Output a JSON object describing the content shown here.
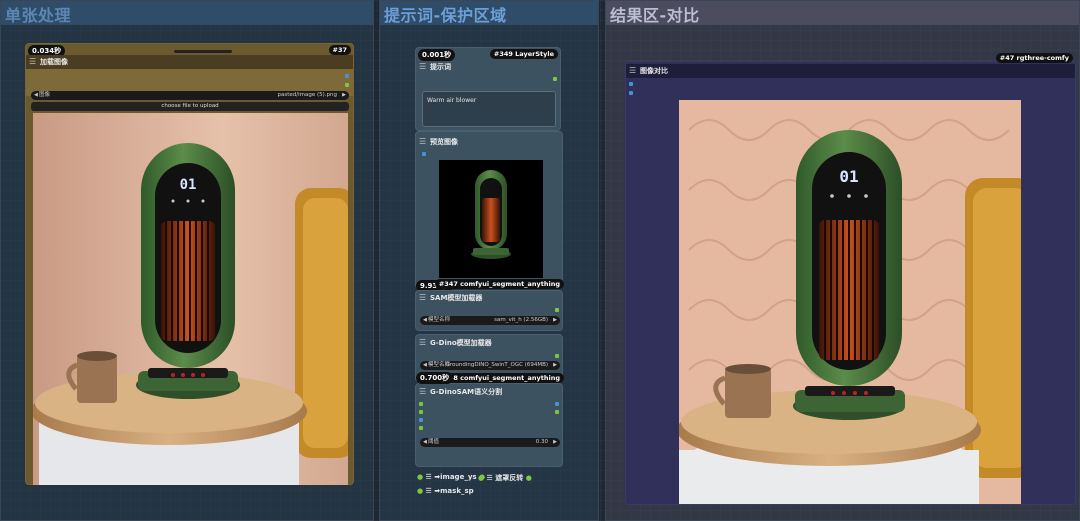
{
  "groups": {
    "single": {
      "title": "单张处理"
    },
    "prompt": {
      "title": "提示词-保护区域"
    },
    "result": {
      "title": "结果区-对比"
    }
  },
  "load_node": {
    "time": "0.034秒",
    "id": "#37",
    "title": "加载图像",
    "image_widget": {
      "label": "图像",
      "value": "pasted/image (5).png"
    },
    "upload_label": "choose file to upload"
  },
  "prompt_node": {
    "time": "0.001秒",
    "id": "#349 LayerStyle",
    "title": "提示词",
    "text": "Warm air blower"
  },
  "preview_node": {
    "title": "预览图像",
    "time": "9.931秒",
    "id": "#347 comfyui_segment_anything"
  },
  "sam_node": {
    "title": "SAM模型加载器",
    "widget_label": "模型名称",
    "widget_value": "sam_vit_h (2.56GB)"
  },
  "gdino_node": {
    "title": "G-Dino模型加载器",
    "widget_label": "模型名称",
    "widget_value": "GroundingDINO_SwinT_OGC (694MB)",
    "id": "#348 comfyui_segment_anything"
  },
  "gdsam_node": {
    "time": "0.700秒",
    "title": "G-DinoSAM语义分割",
    "widget_label": "阈值",
    "widget_value": "0.30"
  },
  "outputs": [
    {
      "label": "image_ys"
    },
    {
      "label": "遮罩反转"
    },
    {
      "label": "mask_sp"
    }
  ],
  "compare_node": {
    "id": "#47 rgthree-comfy",
    "title": "图像对比"
  },
  "heater_display": "01",
  "colors": {
    "accent_green": "#7ec83e",
    "accent_blue": "#4a90d9",
    "heater_green": "#4a7a3e"
  }
}
